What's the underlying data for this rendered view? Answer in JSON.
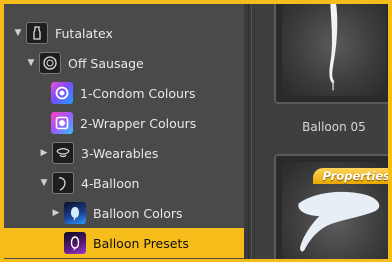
{
  "tree": {
    "items": [
      {
        "label": "Futalatex",
        "expanded": true,
        "icon": "figure-icon"
      },
      {
        "label": "Off Sausage",
        "expanded": true,
        "icon": "lens-icon"
      },
      {
        "label": "1-Condom Colours",
        "icon": "condom-colours-icon"
      },
      {
        "label": "2-Wrapper Colours",
        "icon": "wrapper-colours-icon"
      },
      {
        "label": "3-Wearables",
        "expanded": false,
        "icon": "wearables-icon"
      },
      {
        "label": "4-Balloon",
        "expanded": true,
        "icon": "balloon-outline-icon"
      },
      {
        "label": "Balloon Colors",
        "expanded": false,
        "icon": "balloon-colors-icon"
      },
      {
        "label": "Balloon Presets",
        "selected": true,
        "icon": "balloon-presets-icon"
      }
    ]
  },
  "content": {
    "items": [
      {
        "caption": "Balloon 05"
      },
      {
        "badge": "Properties"
      }
    ]
  },
  "colors": {
    "accent": "#f6bd1a",
    "panel": "#4a4a4a",
    "text": "#e8e8e8"
  }
}
